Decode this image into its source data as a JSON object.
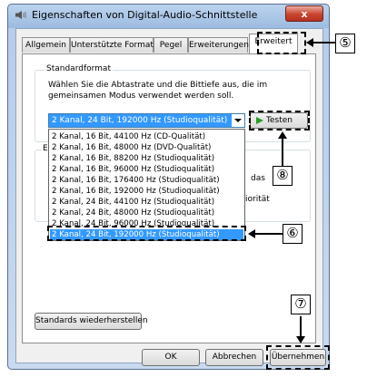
{
  "window": {
    "title": "Eigenschaften von Digital-Audio-Schnittstelle",
    "close_label": "x"
  },
  "tabs": [
    {
      "label": "Allgemein"
    },
    {
      "label": "Unterstützte Formate"
    },
    {
      "label": "Pegel"
    },
    {
      "label": "Erweiterungen"
    },
    {
      "label": "Erweitert",
      "active": true
    }
  ],
  "standard_format": {
    "group_title": "Standardformat",
    "description_line1": "Wählen Sie die Abtastrate und die Bittiefe aus, die im",
    "description_line2": "gemeinsamen Modus verwendet werden soll.",
    "selected_value": "2 Kanal, 24 Bit, 192000 Hz (Studioqualität)",
    "test_button_label": "Testen",
    "options": [
      "2 Kanal, 16 Bit, 44100 Hz (CD-Qualität)",
      "2 Kanal, 16 Bit, 48000 Hz (DVD-Qualität)",
      "2 Kanal, 16 Bit, 88200 Hz (Studioqualität)",
      "2 Kanal, 16 Bit, 96000 Hz (Studioqualität)",
      "2 Kanal, 16 Bit, 176400 Hz (Studioqualität)",
      "2 Kanal, 16 Bit, 192000 Hz (Studioqualität)",
      "2 Kanal, 24 Bit, 44100 Hz (Studioqualität)",
      "2 Kanal, 24 Bit, 48000 Hz (Studioqualität)",
      "2 Kanal, 24 Bit, 96000 Hz (Studioqualität)",
      "2 Kanal, 24 Bit, 192000 Hz (Studioqualität)"
    ]
  },
  "partially_hidden": {
    "group_initial": "E",
    "text_das": "das",
    "text_prioritat": "iorität"
  },
  "buttons": {
    "restore_defaults": "Standards wiederherstellen",
    "ok": "OK",
    "cancel": "Abbrechen",
    "apply": "Übernehmen"
  },
  "callouts": {
    "c5": "⑤",
    "c6": "⑥",
    "c7": "⑦",
    "c8": "⑧"
  },
  "colors": {
    "selection": "#3399ff",
    "title_gradient": "#9dbbe0",
    "close_button": "#c9452f"
  }
}
